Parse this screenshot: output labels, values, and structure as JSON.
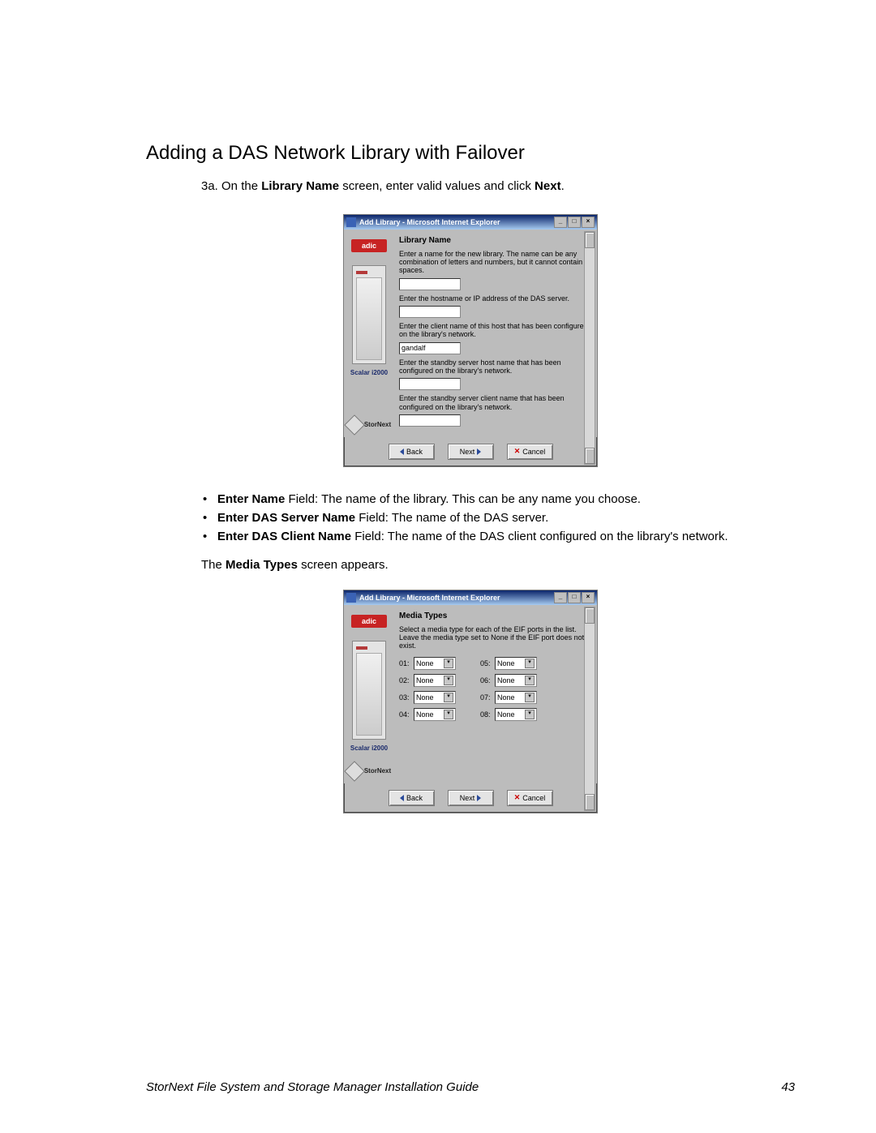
{
  "heading": "Adding a DAS Network Library with Failover",
  "step_prefix": "3a. On the ",
  "step_bold1": "Library Name",
  "step_mid": " screen, enter valid values and click ",
  "step_bold2": "Next",
  "step_suffix": ".",
  "window_title": "Add Library - Microsoft Internet Explorer",
  "sidebar": {
    "brand": "adic",
    "device_label": "Scalar i2000",
    "product": "StorNext"
  },
  "screen1": {
    "title": "Library Name",
    "p1": "Enter a name for the new library. The name can be any combination of letters and numbers, but it cannot contain spaces.",
    "p2": "Enter the hostname or IP address of the DAS server.",
    "p3": "Enter the client name of this host that has been configured on the library's network.",
    "input3_value": "gandalf",
    "p4": "Enter the standby server host name that has been configured on the library's network.",
    "p5": "Enter the standby server client name that has been configured on the library's network."
  },
  "buttons": {
    "back": "Back",
    "next": "Next",
    "cancel": "Cancel"
  },
  "bullets": [
    {
      "b": "Enter Name",
      "rest": " Field: The name of the library. This can be any name you choose."
    },
    {
      "b": "Enter DAS Server Name",
      "rest": " Field: The name of the DAS server."
    },
    {
      "b": "Enter DAS Client Name",
      "rest": " Field: The name of the DAS client configured on the library's network."
    }
  ],
  "after_prefix": "The ",
  "after_bold": "Media Types",
  "after_suffix": " screen appears.",
  "screen2": {
    "title": "Media Types",
    "instr": "Select a media type for each of the EIF ports in the list. Leave the media type set to None if the EIF port does not exist.",
    "ports_left": [
      "01:",
      "02:",
      "03:",
      "04:"
    ],
    "ports_right": [
      "05:",
      "06:",
      "07:",
      "08:"
    ],
    "option": "None"
  },
  "footer_text": "StorNext File System and Storage Manager Installation Guide",
  "page_number": "43"
}
